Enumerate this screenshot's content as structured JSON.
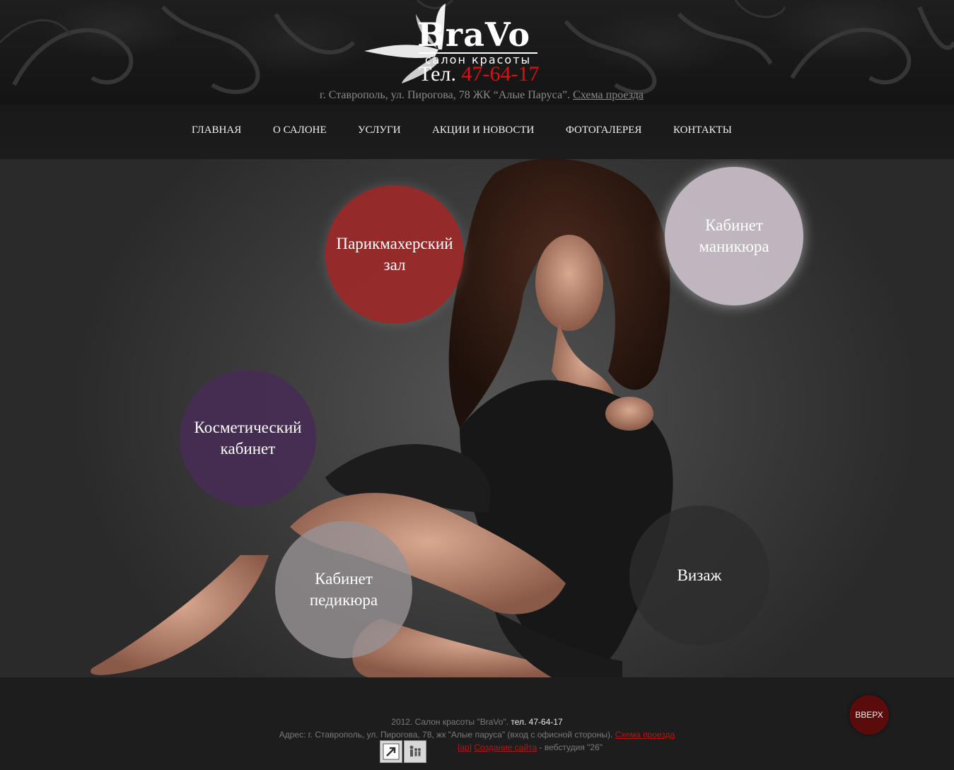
{
  "header": {
    "logo_name": "BraVo",
    "logo_subtitle": "салон красоты",
    "phone_prefix": "Тел.",
    "phone_number": "47-64-17",
    "address_text": "г. Ставрополь, ул. Пирогова, 78 ЖК “Алые Паруса”.",
    "map_link": "Схема проезда"
  },
  "nav": {
    "items": [
      "ГЛАВНАЯ",
      "О САЛОНЕ",
      "УСЛУГИ",
      "АКЦИИ И НОВОСТИ",
      "ФОТОГАЛЕРЕЯ",
      "КОНТАКТЫ"
    ]
  },
  "services": {
    "hair": {
      "line1": "Парикмахерский",
      "line2": "зал"
    },
    "manicure": {
      "line1": "Кабинет",
      "line2": "маникюра"
    },
    "cosmetic": {
      "line1": "Косметический",
      "line2": "кабинет"
    },
    "pedicure": {
      "line1": "Кабинет",
      "line2": "педикюра"
    },
    "visage": {
      "line1": "Визаж"
    }
  },
  "footer": {
    "copyright": "2012. Салон красоты \"BraVo\".",
    "phone": "тел. 47-64-17",
    "address": "Адрес: г. Ставрополь, ул. Пирогова, 78, жк \"Алые паруса\" (вход с офисной стороны).",
    "map_link": "Схема проезда",
    "dev_prefix": "[ap]",
    "dev_link": "Создание сайта",
    "dev_suffix": "- вебстудия \"26\"",
    "up_button": "ВВЕРХ"
  },
  "colors": {
    "accent_red": "#e01010",
    "hair_circle": "#a02828",
    "manicure_circle": "#d7cdd7",
    "cosmetic_circle": "#462d55",
    "pedicure_circle": "#969194",
    "visage_circle": "#2d2d2d"
  }
}
